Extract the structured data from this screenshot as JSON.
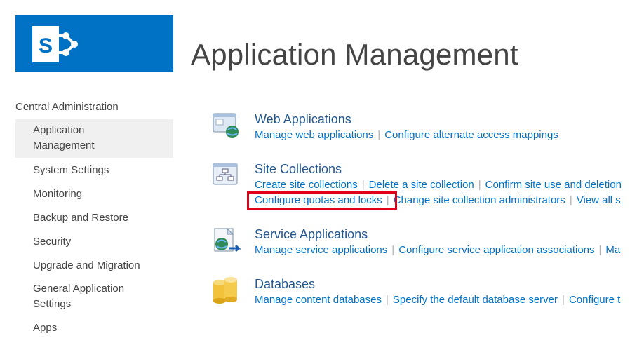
{
  "logo": {
    "letter": "S",
    "icon": "sharepoint-logo-icon"
  },
  "page": {
    "title": "Application Management"
  },
  "nav": {
    "root": "Central Administration",
    "items": [
      {
        "label": "Application\nManagement",
        "selected": true
      },
      {
        "label": "System Settings"
      },
      {
        "label": "Monitoring"
      },
      {
        "label": "Backup and Restore"
      },
      {
        "label": "Security"
      },
      {
        "label": "Upgrade and Migration"
      },
      {
        "label": "General Application\nSettings"
      },
      {
        "label": "Apps"
      }
    ]
  },
  "sections": {
    "web_apps": {
      "title": "Web Applications",
      "icon": "web-applications-icon",
      "links": [
        "Manage web applications",
        "Configure alternate access mappings"
      ]
    },
    "site_collections": {
      "title": "Site Collections",
      "icon": "site-collections-icon",
      "links_row1": [
        "Create site collections",
        "Delete a site collection",
        "Confirm site use and deletion"
      ],
      "links_row2": [
        "Configure quotas and locks",
        "Change site collection administrators",
        "View all s"
      ]
    },
    "service_apps": {
      "title": "Service Applications",
      "icon": "service-applications-icon",
      "links": [
        "Manage service applications",
        "Configure service application associations",
        "Ma"
      ]
    },
    "databases": {
      "title": "Databases",
      "icon": "databases-icon",
      "links": [
        "Manage content databases",
        "Specify the default database server",
        "Configure t"
      ]
    }
  },
  "colors": {
    "brand": "#0072c6",
    "link": "#0072c6",
    "highlight": "#e0001b",
    "selected_bg": "#f0f0f0"
  }
}
